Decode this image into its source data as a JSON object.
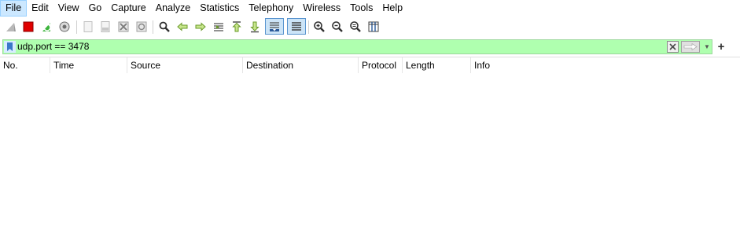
{
  "menubar": {
    "items": [
      "File",
      "Edit",
      "View",
      "Go",
      "Capture",
      "Analyze",
      "Statistics",
      "Telephony",
      "Wireless",
      "Tools",
      "Help"
    ]
  },
  "toolbar": {
    "buttons": [
      {
        "icon": "shark-fin-start-icon",
        "enabled": false
      },
      {
        "icon": "stop-capture-icon",
        "enabled": true
      },
      {
        "icon": "restart-capture-icon",
        "enabled": true
      },
      {
        "icon": "capture-options-gear-icon",
        "enabled": true
      },
      {
        "icon": "open-file-icon",
        "enabled": false
      },
      {
        "icon": "save-file-icon",
        "enabled": false
      },
      {
        "icon": "close-file-icon",
        "enabled": false
      },
      {
        "icon": "reload-file-icon",
        "enabled": false
      },
      {
        "icon": "find-packet-icon",
        "enabled": true
      },
      {
        "icon": "go-back-icon",
        "enabled": true
      },
      {
        "icon": "go-forward-icon",
        "enabled": true
      },
      {
        "icon": "go-to-packet-icon",
        "enabled": true
      },
      {
        "icon": "go-first-packet-icon",
        "enabled": true
      },
      {
        "icon": "go-last-packet-icon",
        "enabled": true
      },
      {
        "icon": "auto-scroll-icon",
        "enabled": true,
        "pressed": true
      },
      {
        "icon": "colorize-icon",
        "enabled": true,
        "pressed": true
      },
      {
        "icon": "zoom-in-icon",
        "enabled": true
      },
      {
        "icon": "zoom-out-icon",
        "enabled": true
      },
      {
        "icon": "zoom-normal-icon",
        "enabled": true
      },
      {
        "icon": "resize-columns-icon",
        "enabled": true
      }
    ]
  },
  "filter": {
    "value": "udp.port == 3478",
    "background_color": "#afffaf"
  },
  "packet_list": {
    "columns": [
      "No.",
      "Time",
      "Source",
      "Destination",
      "Protocol",
      "Length",
      "Info"
    ],
    "rows": []
  }
}
